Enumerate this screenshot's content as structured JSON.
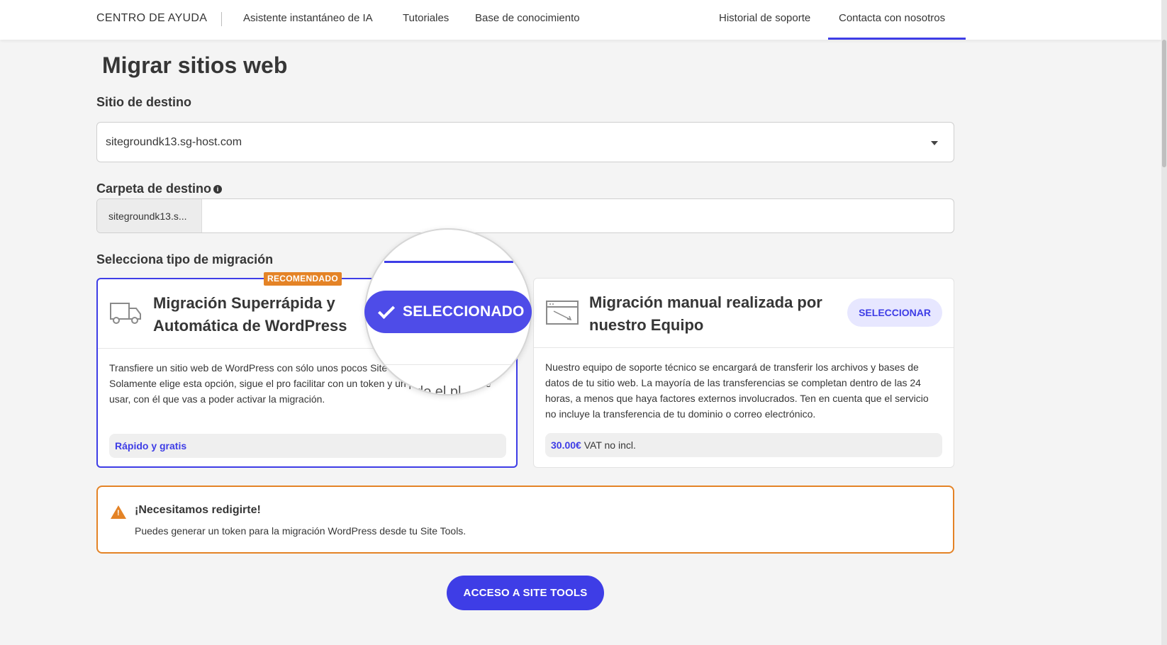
{
  "nav": {
    "brand": "CENTRO DE AYUDA",
    "links": [
      "Asistente instantáneo de IA",
      "Tutoriales",
      "Base de conocimiento"
    ],
    "right_links": [
      "Historial de soporte",
      "Contacta con nosotros"
    ],
    "accent": "#3e3de6"
  },
  "page": {
    "title": "Migrar sitios web"
  },
  "destination_site": {
    "label": "Sitio de destino",
    "value": "sitegroundk13.sg-host.com"
  },
  "destination_folder": {
    "label": "Carpeta de destino",
    "prefix": "sitegroundk13.s...",
    "value": ""
  },
  "migration": {
    "label": "Selecciona tipo de migración",
    "badge": "RECOMENDADO",
    "auto": {
      "title": "Migración Superrápida y Automática de WordPress",
      "selected_label": "SELECCIONADO",
      "description": "Transfiere un sitio web de WordPress con sólo unos pocos SiteGround Migrator. Solamente elige esta opción, sigue el pro facilitar con un token y un plugin muy fácil de usar, con él que vas a poder activar la migración.",
      "magnified_text": "do el pl",
      "price_label": "Rápido y gratis"
    },
    "manual": {
      "title": "Migración manual realizada por nuestro Equipo",
      "select_label": "SELECCIONAR",
      "description": "Nuestro equipo de soporte técnico se encargará de transferir los archivos y bases de datos de tu sitio web. La mayoría de las transferencias se completan dentro de las 24 horas, a menos que haya factores externos involucrados. Ten en cuenta que el servicio no incluye la transferencia de tu dominio o correo electrónico.",
      "price": "30.00€",
      "price_note": "VAT no incl."
    }
  },
  "alert": {
    "title": "¡Necesitamos redigirte!",
    "text": "Puedes generar un token para la migración WordPress desde tu Site Tools.",
    "color": "#e48326"
  },
  "cta": {
    "label": "ACCESO A SITE TOOLS"
  }
}
